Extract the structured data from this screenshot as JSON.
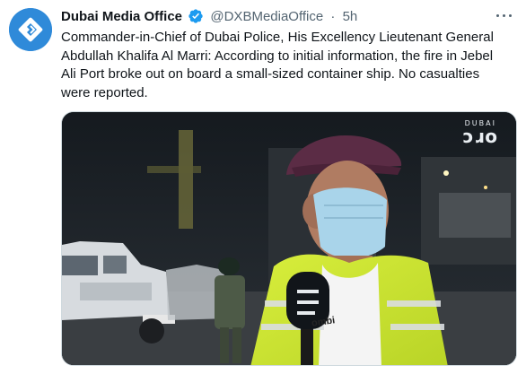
{
  "tweet": {
    "display_name": "Dubai Media Office",
    "handle": "@DXBMediaOffice",
    "separator": "·",
    "timestamp": "5h",
    "text": "Commander-in-Chief of Dubai Police, His Excellency Lieutenant General Abdullah Khalifa Al Marri: According to initial information, the fire in Jebel Ali Port broke out on board a small-sized container ship. No casualties were reported.",
    "icons": {
      "avatar": "dubai-media-office-logo",
      "verified": "verified-badge-icon",
      "more": "more-options-icon"
    },
    "colors": {
      "verified": "#1d9bf0",
      "avatar_bg": "#2f8ad9",
      "secondary_text": "#536471"
    }
  },
  "media": {
    "channel_logo": {
      "top": "DUBAI",
      "mark": "ɔɹo"
    },
    "vest_text_fragment": "ombi"
  }
}
